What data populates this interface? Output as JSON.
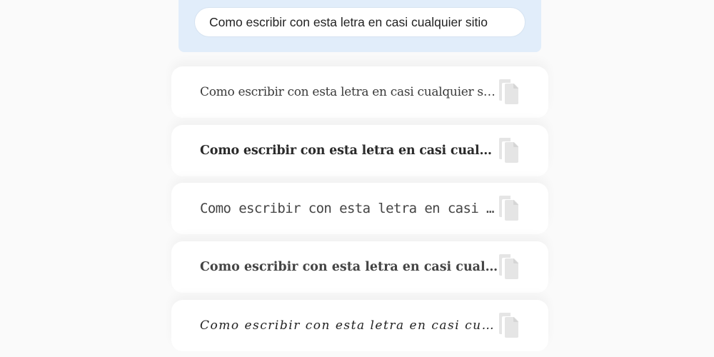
{
  "input": {
    "value": "Como escribir con esta letra en casi cualquier sitio"
  },
  "results": [
    {
      "text": "Como escribir con esta letra en casi cualquier sitio",
      "style": "fraktur"
    },
    {
      "text": "Como escribir con esta letra en casi cualquier sitio",
      "style": "bold-fraktur"
    },
    {
      "text": "Como escribir con esta letra en casi cualquier sitio",
      "style": "monospace"
    },
    {
      "text": "Como escribir con esta letra en casi cualquier sitio",
      "style": "outline-bold"
    },
    {
      "text": "Como escribir con esta letra en casi cualquier sitio",
      "style": "script"
    }
  ],
  "icons": {
    "copy": "copy-icon"
  },
  "colors": {
    "panel": "#e1edfa",
    "background": "#fafafa",
    "card": "#ffffff",
    "icon": "#e4e4e4"
  }
}
